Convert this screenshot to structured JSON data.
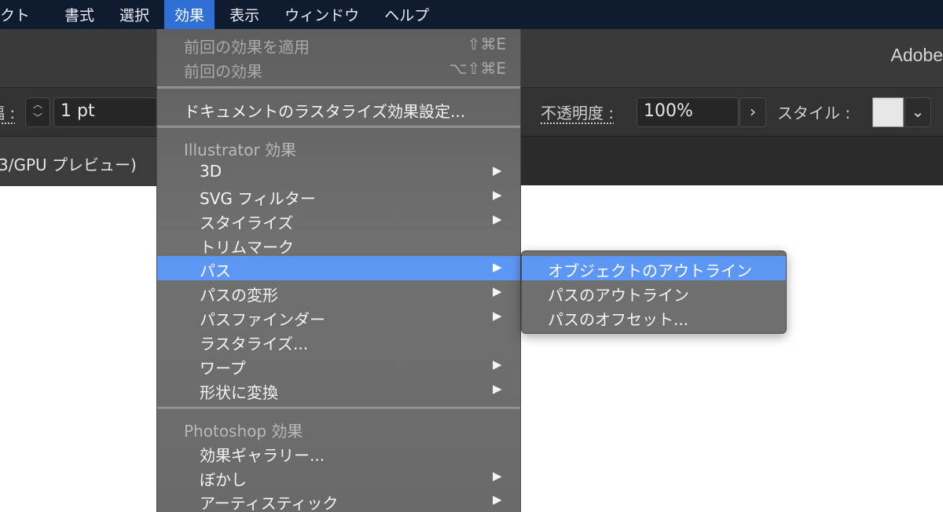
{
  "menubar": {
    "items": [
      {
        "label": "クト",
        "active": false
      },
      {
        "label": "書式",
        "active": false
      },
      {
        "label": "選択",
        "active": false
      },
      {
        "label": "効果",
        "active": true
      },
      {
        "label": "表示",
        "active": false
      },
      {
        "label": "ウィンドウ",
        "active": false
      },
      {
        "label": "ヘルプ",
        "active": false
      }
    ]
  },
  "appbar": {
    "brand": "Adobe"
  },
  "controlbar": {
    "stroke_label_partial": "幅 :",
    "stroke_value": "1 pt",
    "opacity_label": "不透明度 :",
    "opacity_value": "100%",
    "opacity_arrow": "›",
    "style_label": "スタイル :",
    "style_dropdown_glyph": "⌄"
  },
  "tabbar": {
    "tab_text": "3/GPU プレビュー)"
  },
  "effect_menu": {
    "repeat_last": {
      "label": "前回の効果を適用",
      "shortcut": "⇧⌘E"
    },
    "last_effect": {
      "label": "前回の効果",
      "shortcut": "⌥⇧⌘E"
    },
    "raster_settings": {
      "label": "ドキュメントのラスタライズ効果設定..."
    },
    "illustrator_header": "Illustrator 効果",
    "illustrator_items": [
      {
        "label": "3D",
        "submenu": true
      },
      {
        "label": "SVG フィルター",
        "submenu": true
      },
      {
        "label": "スタイライズ",
        "submenu": true
      },
      {
        "label": "トリムマーク",
        "submenu": false
      },
      {
        "label": "パス",
        "submenu": true
      },
      {
        "label": "パスの変形",
        "submenu": true
      },
      {
        "label": "パスファインダー",
        "submenu": true
      },
      {
        "label": "ラスタライズ...",
        "submenu": false
      },
      {
        "label": "ワープ",
        "submenu": true
      },
      {
        "label": "形状に変換",
        "submenu": true
      }
    ],
    "photoshop_header": "Photoshop 効果",
    "photoshop_items": [
      {
        "label": "効果ギャラリー...",
        "submenu": false
      },
      {
        "label": "ぼかし",
        "submenu": true
      },
      {
        "label": "アーティスティック",
        "submenu": true
      }
    ]
  },
  "path_submenu": {
    "items": [
      {
        "label": "オブジェクトのアウトライン",
        "highlighted": true
      },
      {
        "label": "パスのアウトライン",
        "highlighted": false
      },
      {
        "label": "パスのオフセット...",
        "highlighted": false
      }
    ]
  },
  "icons": {
    "submenu_arrow": "▶",
    "stepper": "︿﹀"
  },
  "colors": {
    "menubar_bg": "#0f1b31",
    "menu_active": "#2f6fd6",
    "menu_highlight": "#5d97f5"
  }
}
